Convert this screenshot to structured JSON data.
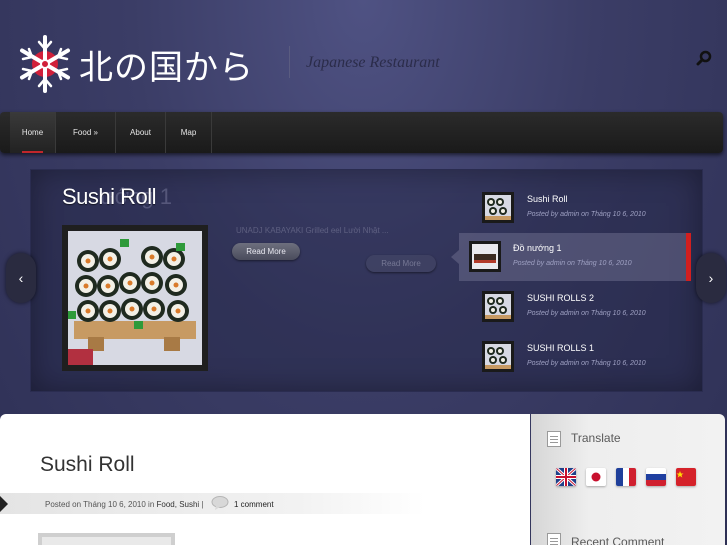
{
  "header": {
    "site_title": "北の国から",
    "tagline": "Japanese Restaurant"
  },
  "nav": {
    "items": [
      {
        "label": "Home"
      },
      {
        "label": "Food »"
      },
      {
        "label": "About"
      },
      {
        "label": "Map"
      }
    ],
    "active_index": 0
  },
  "slider": {
    "current_title": "Sushi Roll",
    "ghost_title": "ướng 1",
    "excerpt": "UNADJ KABAYAKI Grilled eel Lười Nhật ...",
    "read_more_label": "Read More",
    "prev_arrow": "‹",
    "next_arrow": "›",
    "thumbnails": [
      {
        "title": "Sushi Roll",
        "meta": "Posted by admin on Tháng 10 6, 2010",
        "active": false
      },
      {
        "title": "Đồ nướng 1",
        "meta": "Posted by admin on Tháng 10 6, 2010",
        "active": true
      },
      {
        "title": "SUSHI ROLLS 2",
        "meta": "Posted by admin on Tháng 10 6, 2010",
        "active": false
      },
      {
        "title": "SUSHI ROLLS 1",
        "meta": "Posted by admin on Tháng 10 6, 2010",
        "active": false
      }
    ]
  },
  "post": {
    "title": "Sushi Roll",
    "meta_prefix": "Posted on Tháng 10 6, 2010 in",
    "categories": "Food, Sushi",
    "separator": "|",
    "comments": "1 comment"
  },
  "sidebar": {
    "translate_title": "Translate",
    "recent_comments_title": "Recent Comment",
    "flags": [
      "uk-flag-icon",
      "japan-flag-icon",
      "france-flag-icon",
      "russia-flag-icon",
      "china-flag-icon"
    ]
  },
  "colors": {
    "background": "#3b3d63",
    "nav_bg": "#1f1f1f",
    "accent_red": "#d11f1f"
  }
}
